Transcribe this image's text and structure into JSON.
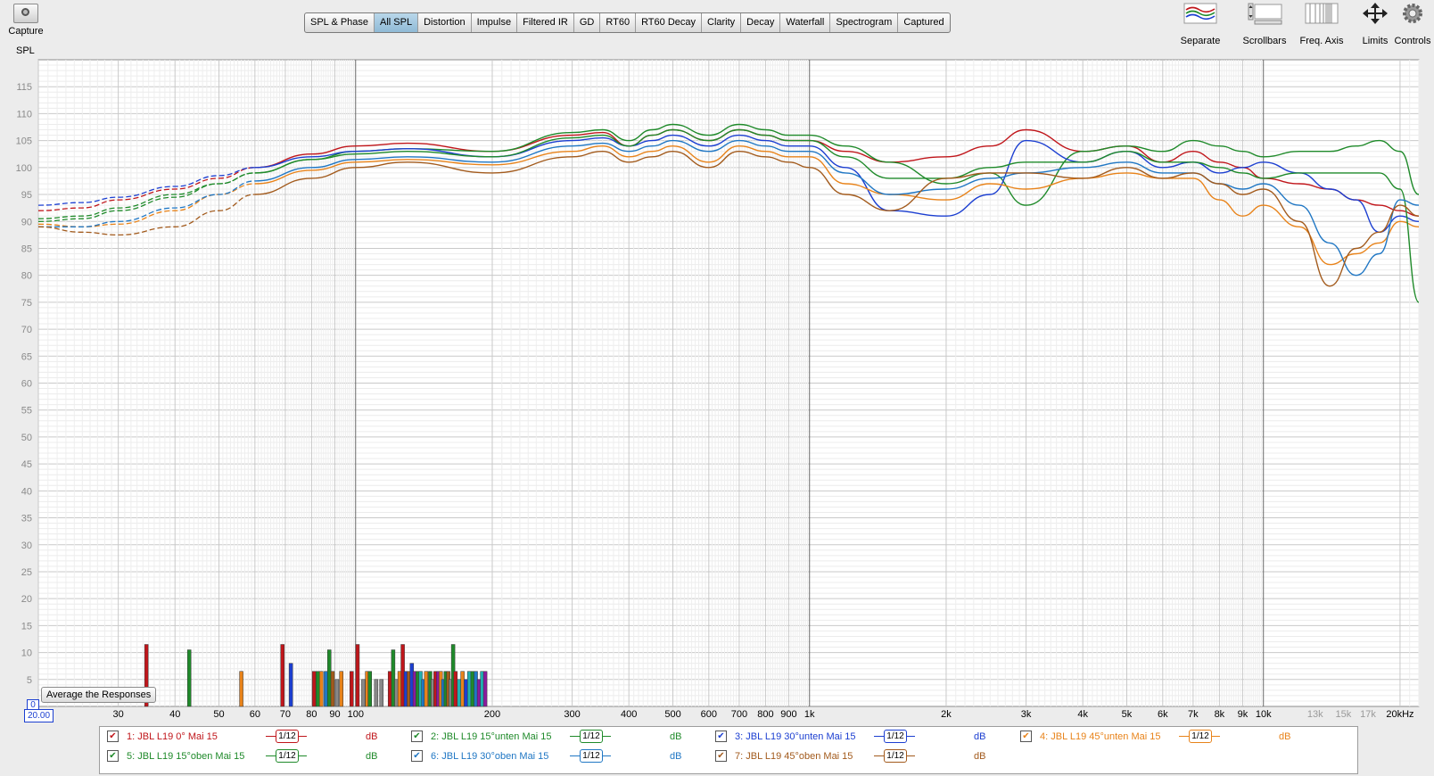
{
  "toolbar": {
    "capture_label": "Capture",
    "tabs": [
      {
        "label": "SPL & Phase",
        "active": false
      },
      {
        "label": "All SPL",
        "active": true
      },
      {
        "label": "Distortion",
        "active": false
      },
      {
        "label": "Impulse",
        "active": false
      },
      {
        "label": "Filtered IR",
        "active": false
      },
      {
        "label": "GD",
        "active": false
      },
      {
        "label": "RT60",
        "active": false
      },
      {
        "label": "RT60 Decay",
        "active": false
      },
      {
        "label": "Clarity",
        "active": false
      },
      {
        "label": "Decay",
        "active": false
      },
      {
        "label": "Waterfall",
        "active": false
      },
      {
        "label": "Spectrogram",
        "active": false
      },
      {
        "label": "Captured",
        "active": false
      }
    ],
    "right_tools": {
      "separate": "Separate",
      "scrollbars": "Scrollbars",
      "freq_axis": "Freq. Axis",
      "limits": "Limits",
      "controls": "Controls"
    }
  },
  "plot": {
    "y_axis_label": "SPL",
    "average_button": "Average the Responses",
    "x_min_value": "20.00",
    "y_min_value": "0"
  },
  "chart_data": {
    "type": "line",
    "ylabel": "SPL",
    "xscale": "log",
    "xlim": [
      20,
      22000
    ],
    "ylim": [
      0,
      120
    ],
    "grid": true,
    "y_ticks": [
      5,
      10,
      15,
      20,
      25,
      30,
      35,
      40,
      45,
      50,
      55,
      60,
      65,
      70,
      75,
      80,
      85,
      90,
      95,
      100,
      105,
      110,
      115
    ],
    "x_tick_labels": [
      {
        "value": 30,
        "label": "30"
      },
      {
        "value": 40,
        "label": "40"
      },
      {
        "value": 50,
        "label": "50"
      },
      {
        "value": 60,
        "label": "60"
      },
      {
        "value": 70,
        "label": "70"
      },
      {
        "value": 80,
        "label": "80"
      },
      {
        "value": 90,
        "label": "90"
      },
      {
        "value": 100,
        "label": "100"
      },
      {
        "value": 200,
        "label": "200"
      },
      {
        "value": 300,
        "label": "300"
      },
      {
        "value": 400,
        "label": "400"
      },
      {
        "value": 500,
        "label": "500"
      },
      {
        "value": 600,
        "label": "600"
      },
      {
        "value": 700,
        "label": "700"
      },
      {
        "value": 800,
        "label": "800"
      },
      {
        "value": 900,
        "label": "900"
      },
      {
        "value": 1000,
        "label": "1k"
      },
      {
        "value": 2000,
        "label": "2k"
      },
      {
        "value": 3000,
        "label": "3k"
      },
      {
        "value": 4000,
        "label": "4k"
      },
      {
        "value": 5000,
        "label": "5k"
      },
      {
        "value": 6000,
        "label": "6k"
      },
      {
        "value": 7000,
        "label": "7k"
      },
      {
        "value": 8000,
        "label": "8k"
      },
      {
        "value": 9000,
        "label": "9k"
      },
      {
        "value": 10000,
        "label": "10k"
      },
      {
        "value": 13000,
        "label": "13k"
      },
      {
        "value": 15000,
        "label": "15k"
      },
      {
        "value": 17000,
        "label": "17k"
      },
      {
        "value": 20000,
        "label": "20kHz"
      }
    ],
    "series": [
      {
        "name": "1: JBL L19 0° Mai 15",
        "color": "#c0161b",
        "x": [
          20,
          25,
          30,
          40,
          50,
          60,
          80,
          100,
          130,
          200,
          300,
          350,
          400,
          450,
          500,
          600,
          700,
          800,
          900,
          1000,
          1200,
          1500,
          2000,
          2500,
          3000,
          4000,
          5000,
          6000,
          7000,
          8000,
          9000,
          10000,
          12000,
          14000,
          16000,
          18000,
          20000,
          22000
        ],
        "y": [
          92,
          92.5,
          94,
          96,
          98,
          100,
          102.5,
          104,
          104.5,
          103,
          106,
          106.5,
          104,
          106,
          107,
          105,
          107,
          106,
          105,
          105,
          103,
          101,
          102,
          104,
          107,
          103,
          104,
          101,
          103,
          101,
          100,
          98,
          97,
          96,
          94,
          93,
          92,
          91
        ]
      },
      {
        "name": "2: JBL L19 15°unten Mai 15",
        "color": "#1f8a2a",
        "x": [
          20,
          25,
          30,
          40,
          50,
          60,
          80,
          100,
          130,
          200,
          300,
          350,
          400,
          450,
          500,
          600,
          700,
          800,
          900,
          1000,
          1200,
          1500,
          2000,
          2500,
          3000,
          4000,
          5000,
          6000,
          7000,
          8000,
          9000,
          10000,
          12000,
          14000,
          16000,
          18000,
          20000,
          22000
        ],
        "y": [
          90,
          90.5,
          92,
          94.5,
          97,
          99,
          101.5,
          103,
          103.5,
          103,
          106.5,
          107,
          105,
          107,
          108,
          106,
          108,
          107,
          106,
          106,
          104,
          101,
          97,
          99,
          93,
          103,
          104,
          103,
          105,
          104,
          103,
          102,
          103,
          103,
          104,
          105,
          103,
          95
        ]
      },
      {
        "name": "3: JBL L19 30°unten Mai 15",
        "color": "#1c3fd1",
        "x": [
          20,
          25,
          30,
          40,
          50,
          60,
          80,
          100,
          130,
          200,
          300,
          350,
          400,
          450,
          500,
          600,
          700,
          800,
          900,
          1000,
          1200,
          1500,
          2000,
          2500,
          3000,
          4000,
          5000,
          6000,
          7000,
          8000,
          9000,
          10000,
          12000,
          14000,
          16000,
          18000,
          20000,
          22000
        ],
        "y": [
          93,
          93.5,
          94.5,
          96.5,
          98.5,
          100,
          102,
          103,
          103.5,
          102,
          105,
          105.5,
          104,
          105,
          106,
          104,
          106,
          105,
          104,
          104,
          100,
          92,
          91,
          95,
          105,
          101,
          103,
          100,
          101,
          99,
          100,
          101,
          99,
          96,
          94,
          88,
          91,
          90
        ]
      },
      {
        "name": "4: JBL L19 45°unten Mai 15",
        "color": "#e8831a",
        "x": [
          20,
          25,
          30,
          40,
          50,
          60,
          80,
          100,
          130,
          200,
          300,
          350,
          400,
          450,
          500,
          600,
          700,
          800,
          900,
          1000,
          1200,
          1500,
          2000,
          2500,
          3000,
          4000,
          5000,
          6000,
          7000,
          8000,
          9000,
          10000,
          12000,
          14000,
          16000,
          18000,
          20000,
          22000
        ],
        "y": [
          89.5,
          89,
          89.5,
          92,
          95,
          97,
          99.5,
          101,
          101.5,
          100.5,
          103,
          104,
          102,
          103,
          104,
          101,
          104,
          103,
          102,
          102,
          97,
          95,
          94,
          97,
          96,
          98,
          99,
          98,
          98,
          94,
          91,
          93,
          89,
          82,
          84,
          86,
          90,
          89
        ]
      },
      {
        "name": "5: JBL L19 15°oben Mai 15",
        "color": "#1f8a2a",
        "x": [
          20,
          25,
          30,
          40,
          50,
          60,
          80,
          100,
          130,
          200,
          300,
          350,
          400,
          450,
          500,
          600,
          700,
          800,
          900,
          1000,
          1200,
          1500,
          2000,
          2500,
          3000,
          4000,
          5000,
          6000,
          7000,
          8000,
          9000,
          10000,
          12000,
          14000,
          16000,
          18000,
          20000,
          22000
        ],
        "y": [
          90.5,
          91,
          92.5,
          95,
          97,
          99,
          101.5,
          102.5,
          103,
          102,
          105.5,
          106,
          104,
          106,
          107,
          105,
          107,
          106,
          105,
          105,
          102,
          98,
          98,
          100,
          101,
          101,
          103,
          101,
          101,
          100,
          99,
          98,
          99,
          99,
          99,
          99,
          96,
          75
        ]
      },
      {
        "name": "6: JBL L19 30°oben Mai 15",
        "color": "#2077c4",
        "x": [
          20,
          25,
          30,
          40,
          50,
          60,
          80,
          100,
          130,
          200,
          300,
          350,
          400,
          450,
          500,
          600,
          700,
          800,
          900,
          1000,
          1200,
          1500,
          2000,
          2500,
          3000,
          4000,
          5000,
          6000,
          7000,
          8000,
          9000,
          10000,
          12000,
          14000,
          16000,
          18000,
          20000,
          22000
        ],
        "y": [
          89,
          89,
          90,
          92.5,
          95,
          97.5,
          100,
          101.5,
          102,
          101,
          104,
          104.5,
          103,
          104,
          105,
          103,
          105,
          104,
          103,
          103,
          99,
          95,
          96,
          98,
          99,
          100,
          101,
          99,
          99,
          97,
          96,
          97,
          93,
          86,
          80,
          84,
          94,
          93
        ]
      },
      {
        "name": "7: JBL L19 45°oben Mai 15",
        "color": "#a25a1c",
        "x": [
          20,
          25,
          30,
          40,
          50,
          60,
          80,
          100,
          130,
          200,
          300,
          350,
          400,
          450,
          500,
          600,
          700,
          800,
          900,
          1000,
          1200,
          1500,
          2000,
          2500,
          3000,
          4000,
          5000,
          6000,
          7000,
          8000,
          9000,
          10000,
          12000,
          14000,
          16000,
          18000,
          20000,
          22000
        ],
        "y": [
          89,
          88,
          87.5,
          89,
          92,
          95,
          98,
          100,
          101,
          99,
          102,
          103,
          101,
          102,
          103,
          100,
          103,
          102,
          101,
          100,
          95,
          92,
          98,
          99,
          99,
          98,
          100,
          98,
          99,
          97,
          95,
          96,
          90,
          78,
          85,
          88,
          93,
          91
        ]
      }
    ],
    "bars": [
      {
        "x": 34.6,
        "h": 11.5,
        "c": "#c0161b"
      },
      {
        "x": 43,
        "h": 10.5,
        "c": "#1f8a2a"
      },
      {
        "x": 56,
        "h": 6.5,
        "c": "#e8831a"
      },
      {
        "x": 69,
        "h": 11.5,
        "c": "#c0161b"
      },
      {
        "x": 72,
        "h": 8,
        "c": "#1c3fd1"
      },
      {
        "x": 81,
        "h": 6.5,
        "c": "#c0161b"
      },
      {
        "x": 82.5,
        "h": 6.5,
        "c": "#1f8a2a"
      },
      {
        "x": 84,
        "h": 6.5,
        "c": "#e8831a"
      },
      {
        "x": 86,
        "h": 6.5,
        "c": "#2077c4"
      },
      {
        "x": 87.5,
        "h": 10.5,
        "c": "#1f8a2a"
      },
      {
        "x": 89,
        "h": 6.5,
        "c": "#a25a1c"
      },
      {
        "x": 91,
        "h": 5,
        "c": "#888888"
      },
      {
        "x": 93,
        "h": 6.5,
        "c": "#e8831a"
      },
      {
        "x": 98,
        "h": 6.5,
        "c": "#c0161b"
      },
      {
        "x": 101,
        "h": 11.5,
        "c": "#c0161b"
      },
      {
        "x": 104,
        "h": 5,
        "c": "#888888"
      },
      {
        "x": 106,
        "h": 6.5,
        "c": "#e8831a"
      },
      {
        "x": 107.5,
        "h": 6.5,
        "c": "#1f8a2a"
      },
      {
        "x": 111,
        "h": 5,
        "c": "#888888"
      },
      {
        "x": 114,
        "h": 5,
        "c": "#888888"
      },
      {
        "x": 119,
        "h": 6.5,
        "c": "#c0161b"
      },
      {
        "x": 121,
        "h": 10.5,
        "c": "#1f8a2a"
      },
      {
        "x": 123,
        "h": 5,
        "c": "#888888"
      },
      {
        "x": 125,
        "h": 6.5,
        "c": "#e8831a"
      },
      {
        "x": 127,
        "h": 11.5,
        "c": "#c0161b"
      },
      {
        "x": 129,
        "h": 6.5,
        "c": "#1c3fd1"
      },
      {
        "x": 131,
        "h": 6.5,
        "c": "#a25a1c"
      },
      {
        "x": 133,
        "h": 8,
        "c": "#1c3fd1"
      },
      {
        "x": 135,
        "h": 6.5,
        "c": "#8b1a9e"
      },
      {
        "x": 137,
        "h": 6.5,
        "c": "#1f8a2a"
      },
      {
        "x": 139,
        "h": 6.5,
        "c": "#20b0b0"
      },
      {
        "x": 141,
        "h": 5,
        "c": "#2077c4"
      },
      {
        "x": 143,
        "h": 6.5,
        "c": "#e8831a"
      },
      {
        "x": 146,
        "h": 6.5,
        "c": "#1f8a2a"
      },
      {
        "x": 148,
        "h": 5,
        "c": "#888888"
      },
      {
        "x": 150,
        "h": 6.5,
        "c": "#c0161b"
      },
      {
        "x": 152,
        "h": 6.5,
        "c": "#8b1a9e"
      },
      {
        "x": 154,
        "h": 6.5,
        "c": "#e8831a"
      },
      {
        "x": 156,
        "h": 5,
        "c": "#2077c4"
      },
      {
        "x": 158,
        "h": 6.5,
        "c": "#1f8a2a"
      },
      {
        "x": 160,
        "h": 6.5,
        "c": "#a25a1c"
      },
      {
        "x": 162,
        "h": 5,
        "c": "#888888"
      },
      {
        "x": 164,
        "h": 11.5,
        "c": "#1f8a2a"
      },
      {
        "x": 166,
        "h": 6.5,
        "c": "#c0161b"
      },
      {
        "x": 169,
        "h": 5,
        "c": "#20b0b0"
      },
      {
        "x": 172,
        "h": 6.5,
        "c": "#e8831a"
      },
      {
        "x": 175,
        "h": 5,
        "c": "#1c3fd1"
      },
      {
        "x": 178,
        "h": 6.5,
        "c": "#20b0b0"
      },
      {
        "x": 181,
        "h": 6.5,
        "c": "#1f8a2a"
      },
      {
        "x": 184,
        "h": 6.5,
        "c": "#2077c4"
      },
      {
        "x": 187,
        "h": 5,
        "c": "#8b1a9e"
      },
      {
        "x": 190,
        "h": 6.5,
        "c": "#20b0b0"
      },
      {
        "x": 193,
        "h": 6.5,
        "c": "#8b1a9e"
      }
    ]
  },
  "legend": {
    "items": [
      {
        "label": "1: JBL L19 0° Mai 15",
        "color": "#c0161b",
        "smoothing": "1/12",
        "unit": "dB",
        "checked": true
      },
      {
        "label": "2: JBL L19 15°unten Mai 15",
        "color": "#1f8a2a",
        "smoothing": "1/12",
        "unit": "dB",
        "checked": true
      },
      {
        "label": "3: JBL L19 30°unten Mai 15",
        "color": "#1c3fd1",
        "smoothing": "1/12",
        "unit": "dB",
        "checked": true
      },
      {
        "label": "4: JBL L19 45°unten Mai 15",
        "color": "#e8831a",
        "smoothing": "1/12",
        "unit": "dB",
        "checked": true
      },
      {
        "label": "5: JBL L19 15°oben Mai 15",
        "color": "#1f8a2a",
        "smoothing": "1/12",
        "unit": "dB",
        "checked": true
      },
      {
        "label": "6: JBL L19 30°oben Mai 15",
        "color": "#2077c4",
        "smoothing": "1/12",
        "unit": "dB",
        "checked": true
      },
      {
        "label": "7: JBL L19 45°oben Mai 15",
        "color": "#a25a1c",
        "smoothing": "1/12",
        "unit": "dB",
        "checked": true
      }
    ]
  }
}
